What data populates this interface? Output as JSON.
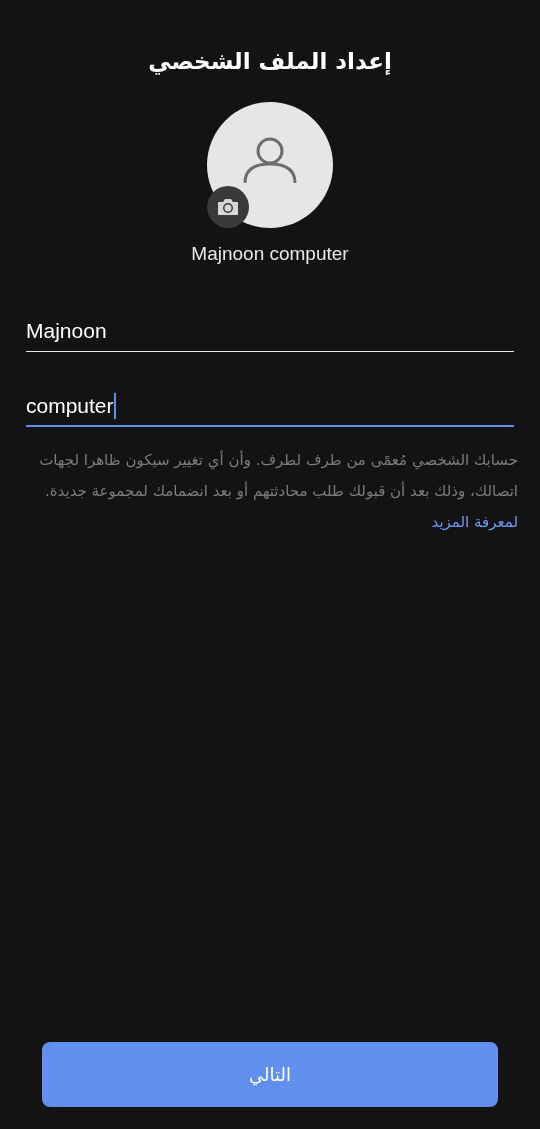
{
  "title": "إعداد الملف الشخصي",
  "profile": {
    "display_name": "Majnoon computer"
  },
  "fields": [
    {
      "value": "Majnoon",
      "focused": false
    },
    {
      "value": "computer",
      "focused": true
    }
  ],
  "info": {
    "text": "حسابك الشخصي مُعمًى من طرف لطرف. وأن أي تغيير سيكون ظاهرا لجهات اتصالك، وذلك بعد أن قبولك طلب محادثتهم أو بعد انضمامك لمجموعة جديدة.",
    "link": "لمعرفة المزيد"
  },
  "next_button": {
    "label": "التالي"
  }
}
